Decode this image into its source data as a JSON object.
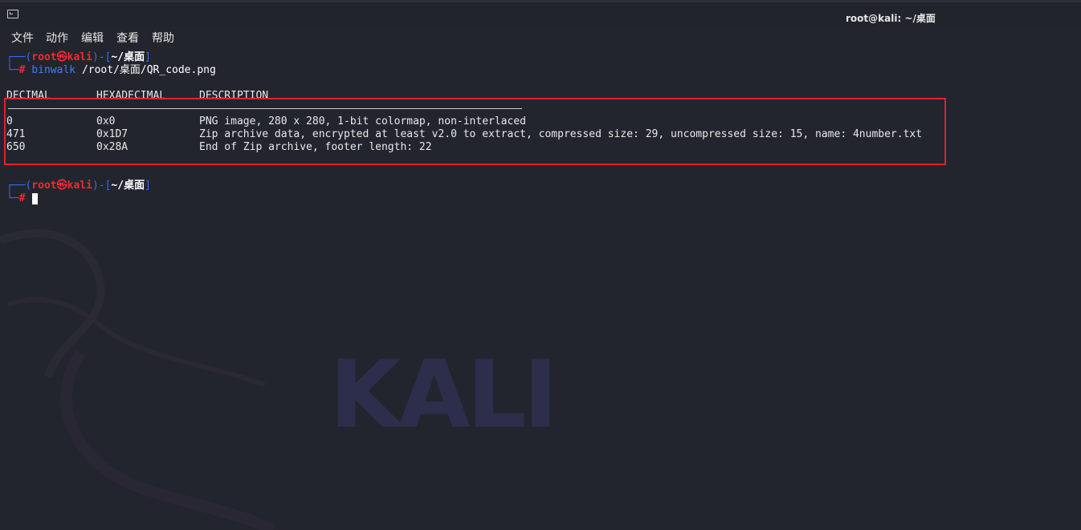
{
  "window": {
    "title": "root@kali: ~/桌面"
  },
  "menu": [
    "文件",
    "动作",
    "编辑",
    "查看",
    "帮助"
  ],
  "prompt1": {
    "frame_open": "┌──(",
    "user": "root㉿kali",
    "frame_mid": ")-[",
    "path": "~/桌面",
    "frame_close": "]",
    "frame_bottom": "└─",
    "hash": "#",
    "command": "binwalk",
    "argument": "/root/桌面/QR_code.png"
  },
  "table": {
    "headers": [
      "DECIMAL",
      "HEXADECIMAL",
      "DESCRIPTION"
    ],
    "rows": [
      {
        "decimal": "0",
        "hex": "0x0",
        "description": "PNG image, 280 x 280, 1-bit colormap, non-interlaced"
      },
      {
        "decimal": "471",
        "hex": "0x1D7",
        "description": "Zip archive data, encrypted at least v2.0 to extract, compressed size: 29, uncompressed size: 15, name: 4number.txt"
      },
      {
        "decimal": "650",
        "hex": "0x28A",
        "description": "End of Zip archive, footer length: 22"
      }
    ]
  },
  "prompt2": {
    "frame_open": "┌──(",
    "user": "root㉿kali",
    "frame_mid": ")-[",
    "path": "~/桌面",
    "frame_close": "]",
    "frame_bottom": "└─",
    "hash": "#"
  },
  "wallpaper": {
    "text": "KALI"
  },
  "colors": {
    "background": "#23252e",
    "prompt_red": "#ee2c2c",
    "frame_blue": "#2d6ef0",
    "highlight_red": "#e0222b"
  }
}
